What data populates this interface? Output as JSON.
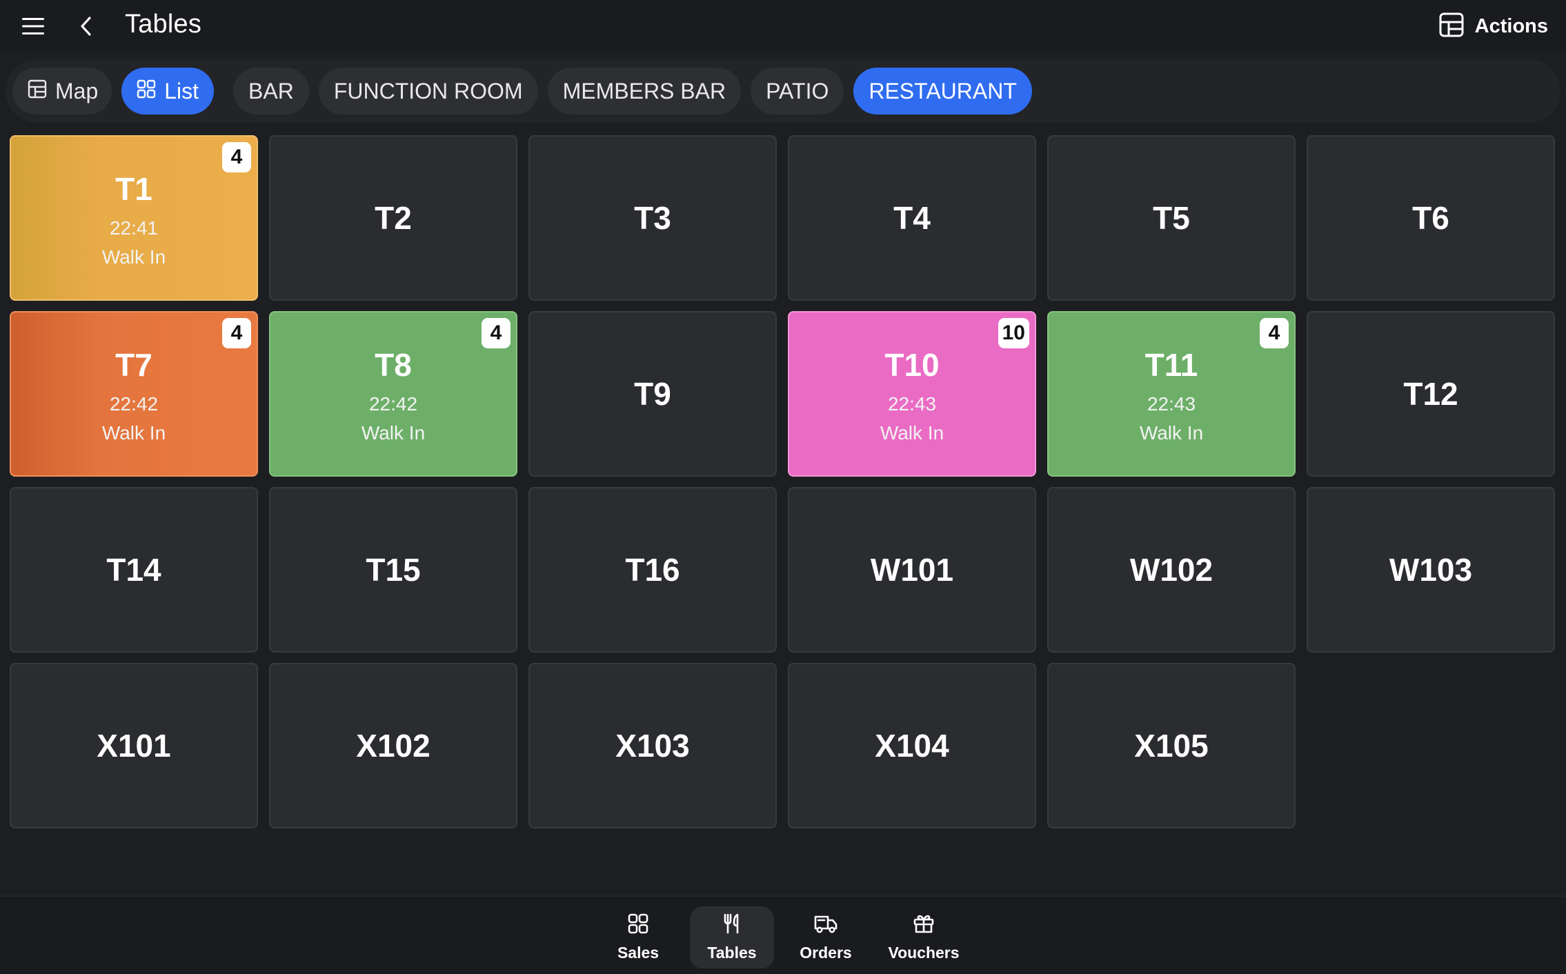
{
  "header": {
    "title": "Tables",
    "actions_label": "Actions",
    "menu_icon": "hamburger-menu-icon",
    "back_icon": "chevron-left-icon",
    "actions_icon": "layout-dashboard-icon"
  },
  "filters": {
    "view_toggle": [
      {
        "label": "Map",
        "icon": "map-layout-icon",
        "active": false
      },
      {
        "label": "List",
        "icon": "grid-icon",
        "active": true
      }
    ],
    "areas": [
      {
        "label": "BAR",
        "active": false
      },
      {
        "label": "FUNCTION ROOM",
        "active": false
      },
      {
        "label": "MEMBERS BAR",
        "active": false
      },
      {
        "label": "PATIO",
        "active": false
      },
      {
        "label": "RESTAURANT",
        "active": true
      }
    ],
    "active_color": "#2f6cf0"
  },
  "tables": [
    {
      "name": "T1",
      "badge": "4",
      "time": "22:41",
      "status": "Walk In",
      "color": "yellow"
    },
    {
      "name": "T2"
    },
    {
      "name": "T3"
    },
    {
      "name": "T4"
    },
    {
      "name": "T5"
    },
    {
      "name": "T6"
    },
    {
      "name": "T7",
      "badge": "4",
      "time": "22:42",
      "status": "Walk In",
      "color": "orange"
    },
    {
      "name": "T8",
      "badge": "4",
      "time": "22:42",
      "status": "Walk In",
      "color": "green"
    },
    {
      "name": "T9"
    },
    {
      "name": "T10",
      "badge": "10",
      "time": "22:43",
      "status": "Walk In",
      "color": "pink"
    },
    {
      "name": "T11",
      "badge": "4",
      "time": "22:43",
      "status": "Walk In",
      "color": "green"
    },
    {
      "name": "T12"
    },
    {
      "name": "T14"
    },
    {
      "name": "T15"
    },
    {
      "name": "T16"
    },
    {
      "name": "W101"
    },
    {
      "name": "W102"
    },
    {
      "name": "W103"
    },
    {
      "name": "X101"
    },
    {
      "name": "X102"
    },
    {
      "name": "X103"
    },
    {
      "name": "X104"
    },
    {
      "name": "X105"
    }
  ],
  "status_colors": {
    "yellow": "#ebae4b",
    "orange": "#e87a41",
    "green": "#6daf68",
    "pink": "#ea6bc4",
    "empty": "#2b2c30"
  },
  "bottom_nav": [
    {
      "label": "Sales",
      "icon": "grid-icon",
      "active": false
    },
    {
      "label": "Tables",
      "icon": "fork-knife-icon",
      "active": true
    },
    {
      "label": "Orders",
      "icon": "delivery-truck-icon",
      "active": false
    },
    {
      "label": "Vouchers",
      "icon": "gift-icon",
      "active": false
    }
  ]
}
